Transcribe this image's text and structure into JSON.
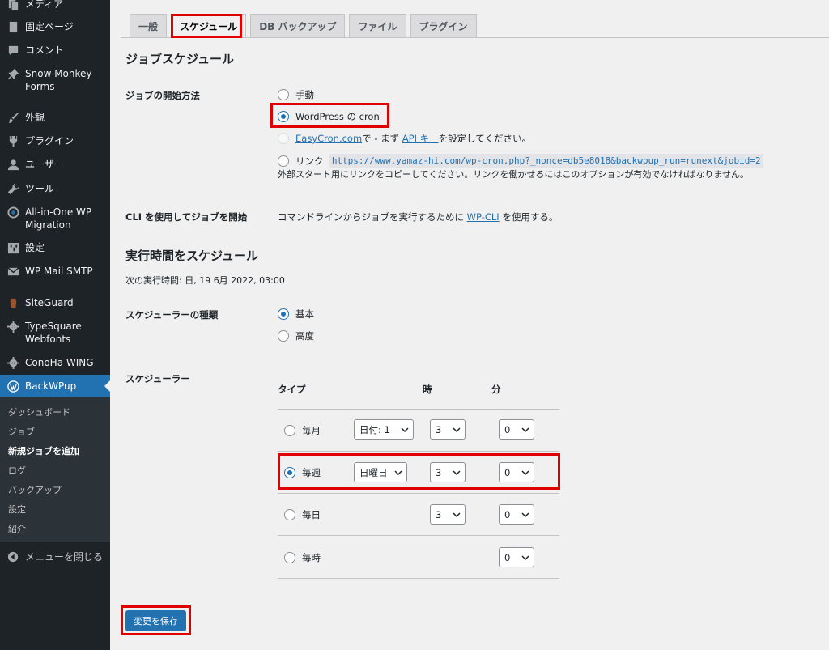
{
  "sidebar": {
    "items": [
      {
        "label": "メディア",
        "icon": "media-icon"
      },
      {
        "label": "固定ページ",
        "icon": "page-icon"
      },
      {
        "label": "コメント",
        "icon": "comment-icon"
      },
      {
        "label": "Snow Monkey Forms",
        "icon": "pin-icon"
      },
      {
        "label": "外観",
        "icon": "brush-icon"
      },
      {
        "label": "プラグイン",
        "icon": "plugin-icon"
      },
      {
        "label": "ユーザー",
        "icon": "user-icon"
      },
      {
        "label": "ツール",
        "icon": "wrench-icon"
      },
      {
        "label": "All-in-One WP Migration",
        "icon": "migration-icon"
      },
      {
        "label": "設定",
        "icon": "settings-icon"
      },
      {
        "label": "WP Mail SMTP",
        "icon": "mail-icon"
      },
      {
        "label": "SiteGuard",
        "icon": "siteguard-icon"
      },
      {
        "label": "TypeSquare Webfonts",
        "icon": "gear-icon"
      },
      {
        "label": "ConoHa WING",
        "icon": "gear-icon"
      },
      {
        "label": "BackWPup",
        "icon": "wordpress-icon"
      }
    ],
    "submenu": [
      "ダッシュボード",
      "ジョブ",
      "新規ジョブを追加",
      "ログ",
      "バックアップ",
      "設定",
      "紹介"
    ],
    "collapse": "メニューを閉じる"
  },
  "tabs": [
    "一般",
    "スケジュール",
    "DB バックアップ",
    "ファイル",
    "プラグイン"
  ],
  "job_schedule": {
    "heading": "ジョブスケジュール",
    "start_label": "ジョブの開始方法",
    "opt_manual": "手動",
    "opt_cron": "WordPress の cron",
    "opt_easycron_link": "EasyCron.com",
    "opt_easycron_mid": "で - まず",
    "opt_easycron_api": "API キー",
    "opt_easycron_end": "を設定してください。",
    "opt_link": "リンク",
    "link_url": "https://www.yamaz-hi.com/wp-cron.php?_nonce=db5e8018&backwpup_run=runext&jobid=2",
    "link_desc": "外部スタート用にリンクをコピーしてください。リンクを働かせるにはこのオプションが有効でなければなりません。",
    "cli_label": "CLI を使用してジョブを開始",
    "cli_text_pre": "コマンドラインからジョブを実行するために",
    "cli_link": "WP-CLI",
    "cli_text_post": "を使用する。"
  },
  "run_schedule": {
    "heading": "実行時間をスケジュール",
    "next_run": "次の実行時間: 日, 19 6月 2022, 03:00",
    "type_label": "スケジューラーの種類",
    "type_basic": "基本",
    "type_advanced": "高度",
    "scheduler_label": "スケジューラー",
    "col_type": "タイプ",
    "col_hour": "時",
    "col_min": "分",
    "rows": [
      {
        "label": "毎月",
        "day": "日付: 1",
        "hour": "3",
        "min": "0"
      },
      {
        "label": "毎週",
        "day": "日曜日",
        "hour": "3",
        "min": "0"
      },
      {
        "label": "毎日",
        "hour": "3",
        "min": "0"
      },
      {
        "label": "毎時",
        "min": "0"
      }
    ]
  },
  "save_label": "変更を保存",
  "colors": {
    "accent": "#2271b1",
    "highlight": "#e00000",
    "sidebar": "#1d2327"
  }
}
